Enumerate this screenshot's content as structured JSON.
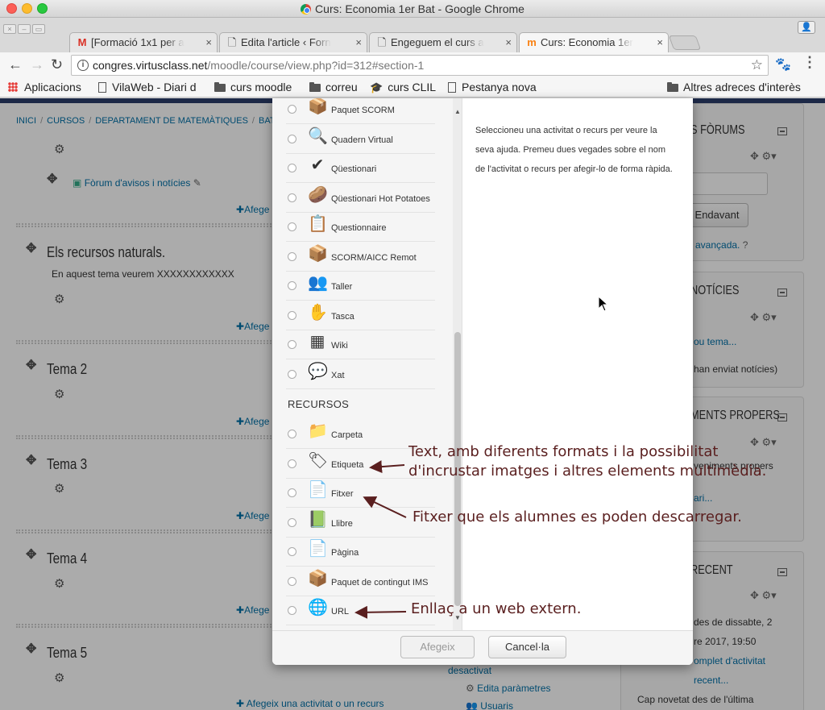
{
  "window": {
    "title": "Curs: Economia 1er Bat - Google Chrome"
  },
  "tabs": [
    {
      "label": "[Formació 1x1 per a",
      "icon": "gmail-icon"
    },
    {
      "label": "Edita l'article ‹ Forn",
      "icon": "page-icon"
    },
    {
      "label": "Engeguem el curs a",
      "icon": "page-icon"
    },
    {
      "label": "Curs: Economia 1er",
      "icon": "moodle-icon",
      "active": true
    }
  ],
  "omnibox": {
    "host": "congres.virtusclass.net",
    "path": "/moodle/course/view.php?id=312#section-1"
  },
  "bookmarks": [
    {
      "label": "Aplicacions",
      "icon": "apps-icon"
    },
    {
      "label": "VilaWeb - Diari d",
      "icon": "page-icon"
    },
    {
      "label": "curs moodle",
      "icon": "folder-icon"
    },
    {
      "label": "correu",
      "icon": "folder-icon"
    },
    {
      "label": "curs CLIL",
      "icon": "graduation-cap-icon"
    },
    {
      "label": "Pestanya nova",
      "icon": "page-icon"
    },
    {
      "label": "Altres adreces d'interès",
      "icon": "folder-icon"
    }
  ],
  "breadcrumb": [
    "INICI",
    "CURSOS",
    "DEPARTAMENT DE MATEMÀTIQUES",
    "BATXI"
  ],
  "course": {
    "forum_link": "Fòrum d'avisos i notícies",
    "add_label": "Afege",
    "add_label_last": "Afegeix una activitat o un recurs",
    "sections": [
      {
        "title": "Els recursos naturals.",
        "summary": "En aquest tema veurem XXXXXXXXXXXX"
      },
      {
        "title": "Tema 2"
      },
      {
        "title": "Tema 3"
      },
      {
        "title": "Tema 4"
      },
      {
        "title": "Tema 5"
      }
    ]
  },
  "blocks": {
    "forums": {
      "title": "S FÒRUMS",
      "button": "Endavant",
      "advanced": "avançada."
    },
    "news": {
      "title": "NOTÍCIES",
      "link": "ou tema...",
      "text": "han enviat notícies)"
    },
    "events": {
      "title": "MENTS PROPERS",
      "line1": "veniments propers",
      "link": "ari..."
    },
    "recent": {
      "title": "RECENT",
      "line1": "des de dissabte, 2",
      "line2": "re 2017, 19:50",
      "link1": "omplet d'activitat",
      "link2": "recent...",
      "line3": "Cap novetat des de l'última"
    }
  },
  "behind_modal": {
    "desactivat": "desactivat",
    "edit_params": "Edita paràmetres",
    "users": "Usuaris"
  },
  "modal": {
    "activities": [
      {
        "label": "Paquet SCORM",
        "icon": "scorm-package-icon",
        "glyph": "📦"
      },
      {
        "label": "Quadern Virtual",
        "icon": "virtual-notebook-icon",
        "glyph": "🔍"
      },
      {
        "label": "Qüestionari",
        "icon": "quiz-icon",
        "glyph": "✔"
      },
      {
        "label": "Qüestionari Hot Potatoes",
        "icon": "hot-potatoes-icon",
        "glyph": "🥔"
      },
      {
        "label": "Questionnaire",
        "icon": "questionnaire-icon",
        "glyph": "📋"
      },
      {
        "label": "SCORM/AICC Remot",
        "icon": "scorm-remote-icon",
        "glyph": "📦"
      },
      {
        "label": "Taller",
        "icon": "workshop-icon",
        "glyph": "👥"
      },
      {
        "label": "Tasca",
        "icon": "assignment-icon",
        "glyph": "✋"
      },
      {
        "label": "Wiki",
        "icon": "wiki-icon",
        "glyph": "▦"
      },
      {
        "label": "Xat",
        "icon": "chat-icon",
        "glyph": "💬"
      }
    ],
    "resources_heading": "RECURSOS",
    "resources": [
      {
        "label": "Carpeta",
        "icon": "folder-icon",
        "glyph": "📁"
      },
      {
        "label": "Etiqueta",
        "icon": "label-icon",
        "glyph": "🏷"
      },
      {
        "label": "Fitxer",
        "icon": "file-icon",
        "glyph": "📄"
      },
      {
        "label": "Llibre",
        "icon": "book-icon",
        "glyph": "📗"
      },
      {
        "label": "Pàgina",
        "icon": "page-icon",
        "glyph": "📄"
      },
      {
        "label": "Paquet de contingut IMS",
        "icon": "ims-package-icon",
        "glyph": "📦"
      },
      {
        "label": "URL",
        "icon": "url-icon",
        "glyph": "🌐"
      }
    ],
    "help": "Seleccioneu una activitat o recurs per veure la seva ajuda. Premeu dues vegades sobre el nom de l'activitat o recurs per afegir-lo de forma ràpida.",
    "add_button": "Afegeix",
    "cancel_button": "Cancel·la"
  },
  "annotations": {
    "etiqueta_line1": "Text, amb diferents formats i la possibilitat",
    "etiqueta_line2": "d'incrustar imatges i altres elements multimèdia.",
    "fitxer": "Fitxer que els alumnes es poden descarregar.",
    "url": "Enllaç a un web extern."
  },
  "colors": {
    "annotation": "#5a1f1f",
    "link": "#0070a8"
  }
}
